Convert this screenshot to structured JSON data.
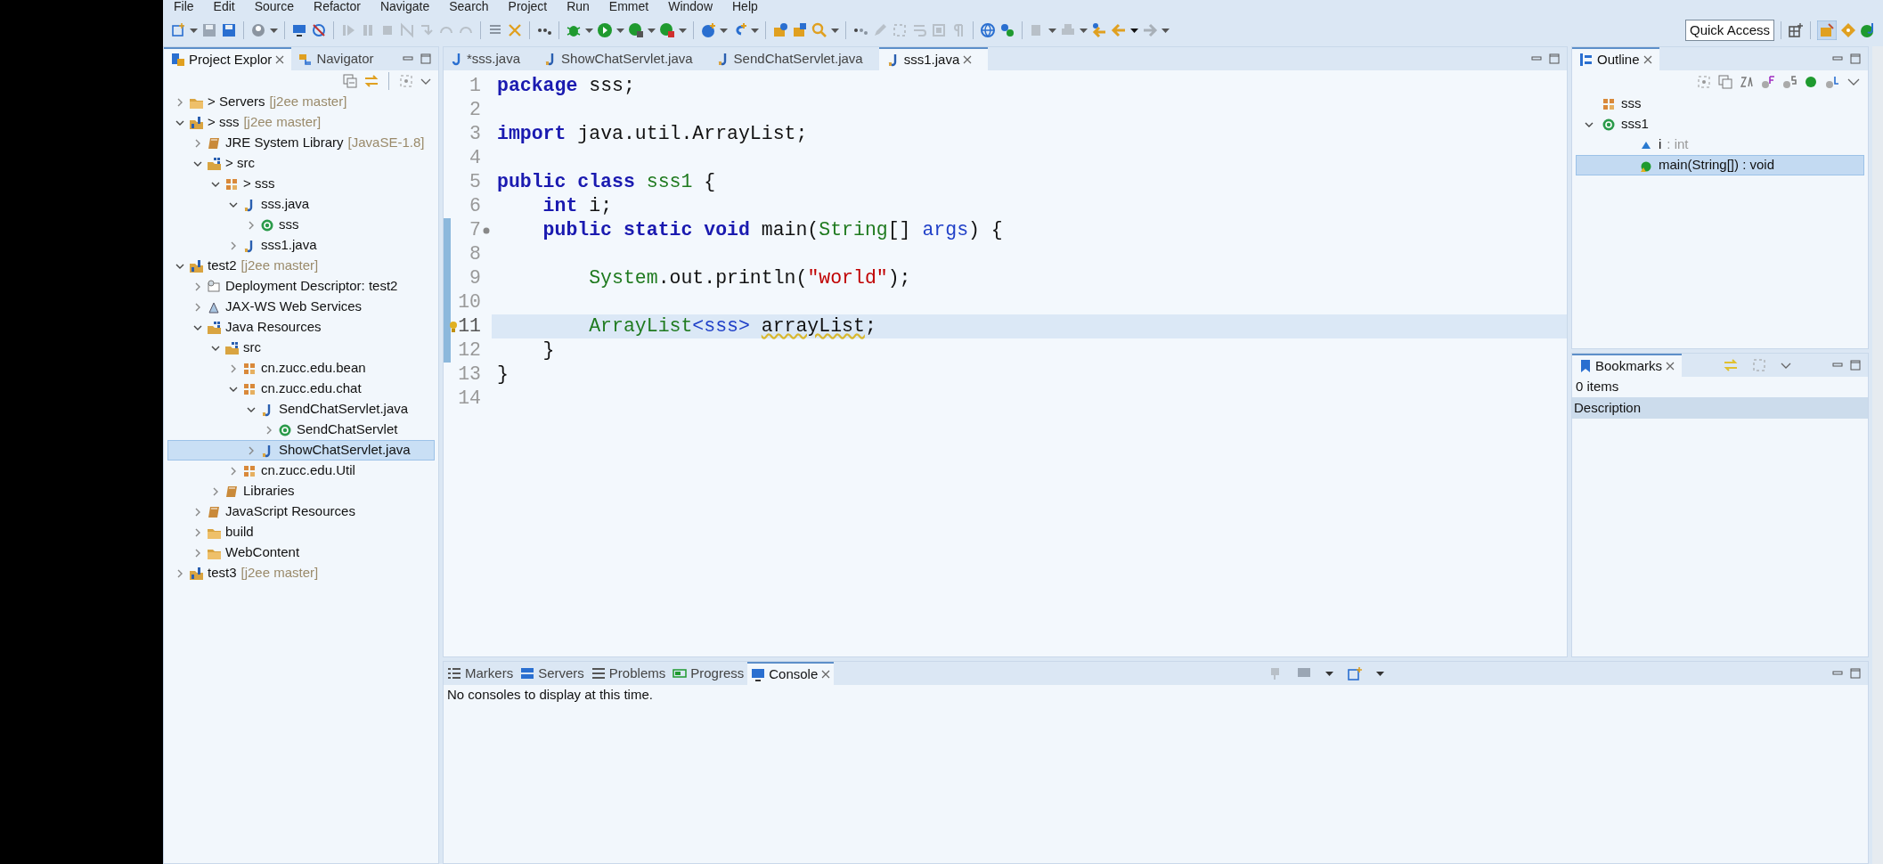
{
  "menu": [
    "File",
    "Edit",
    "Source",
    "Refactor",
    "Navigate",
    "Search",
    "Project",
    "Run",
    "Emmet",
    "Window",
    "Help"
  ],
  "toolbar": {
    "quick_access": "Quick Access"
  },
  "project_explorer": {
    "tabs": [
      {
        "label": "Project Explor",
        "selected": true
      },
      {
        "label": "Navigator",
        "selected": false
      }
    ],
    "tree": [
      {
        "label": "> Servers",
        "decoration": "[j2ee master]",
        "kind": "folder",
        "expanded": false,
        "selected": false
      },
      {
        "label": "> sss",
        "decoration": "[j2ee master]",
        "kind": "project",
        "expanded": true,
        "selected": false,
        "children": [
          {
            "label": "JRE System Library",
            "decoration": "[JavaSE-1.8]",
            "kind": "library",
            "expanded": false,
            "selected": false
          },
          {
            "label": "> src",
            "kind": "source-folder",
            "expanded": true,
            "selected": false,
            "children": [
              {
                "label": "> sss",
                "kind": "package",
                "expanded": true,
                "selected": false,
                "children": [
                  {
                    "label": "sss.java",
                    "kind": "java-file",
                    "expanded": true,
                    "selected": false,
                    "children": [
                      {
                        "label": "sss",
                        "kind": "class",
                        "expanded": false,
                        "selected": false
                      }
                    ]
                  },
                  {
                    "label": "sss1.java",
                    "kind": "java-file",
                    "expanded": false,
                    "selected": false
                  }
                ]
              }
            ]
          }
        ]
      },
      {
        "label": "test2",
        "decoration": "[j2ee master]",
        "kind": "project",
        "expanded": true,
        "selected": false,
        "children": [
          {
            "label": "Deployment Descriptor: test2",
            "kind": "descriptor",
            "expanded": false,
            "selected": false
          },
          {
            "label": "JAX-WS Web Services",
            "kind": "webservice",
            "expanded": false,
            "selected": false
          },
          {
            "label": "Java Resources",
            "kind": "source-folder",
            "expanded": true,
            "selected": false,
            "children": [
              {
                "label": "src",
                "kind": "source-folder",
                "expanded": true,
                "selected": false,
                "children": [
                  {
                    "label": "cn.zucc.edu.bean",
                    "kind": "package",
                    "expanded": false,
                    "selected": false
                  },
                  {
                    "label": "cn.zucc.edu.chat",
                    "kind": "package",
                    "expanded": true,
                    "selected": false,
                    "children": [
                      {
                        "label": "SendChatServlet.java",
                        "kind": "java-file",
                        "expanded": true,
                        "selected": false,
                        "children": [
                          {
                            "label": "SendChatServlet",
                            "kind": "class",
                            "expanded": false,
                            "selected": false
                          }
                        ]
                      },
                      {
                        "label": "ShowChatServlet.java",
                        "kind": "java-file",
                        "expanded": false,
                        "selected": true
                      }
                    ]
                  },
                  {
                    "label": "cn.zucc.edu.Util",
                    "kind": "package",
                    "expanded": false,
                    "selected": false
                  }
                ]
              },
              {
                "label": "Libraries",
                "kind": "library",
                "expanded": false,
                "selected": false
              }
            ]
          },
          {
            "label": "JavaScript Resources",
            "kind": "library",
            "expanded": false,
            "selected": false
          },
          {
            "label": "build",
            "kind": "folder",
            "expanded": false,
            "selected": false
          },
          {
            "label": "WebContent",
            "kind": "folder",
            "expanded": false,
            "selected": false
          }
        ]
      },
      {
        "label": "test3",
        "decoration": "[j2ee master]",
        "kind": "project",
        "expanded": false,
        "selected": false
      }
    ]
  },
  "editor": {
    "tabs": [
      {
        "label": "*sss.java",
        "selected": false
      },
      {
        "label": "ShowChatServlet.java",
        "selected": false
      },
      {
        "label": "SendChatServlet.java",
        "selected": false
      },
      {
        "label": "sss1.java",
        "selected": true
      }
    ],
    "lines": [
      {
        "number": "1",
        "current": false,
        "range": false,
        "override": false,
        "warning": false,
        "tokens": [
          {
            "kind": "keyword",
            "text": "package"
          },
          {
            "kind": "plain",
            "text": " sss;"
          }
        ]
      },
      {
        "number": "2",
        "current": false,
        "range": false,
        "override": false,
        "warning": false
      },
      {
        "number": "3",
        "current": false,
        "range": false,
        "override": false,
        "warning": false,
        "tokens": [
          {
            "kind": "keyword",
            "text": "import"
          },
          {
            "kind": "plain",
            "text": " java.util.ArrayList;"
          }
        ]
      },
      {
        "number": "4",
        "current": false,
        "range": false,
        "override": false,
        "warning": false
      },
      {
        "number": "5",
        "current": false,
        "range": false,
        "override": false,
        "warning": false,
        "tokens": [
          {
            "kind": "keyword",
            "text": "public class"
          },
          {
            "kind": "type",
            "text": " sss1"
          },
          {
            "kind": "plain",
            "text": " {"
          }
        ]
      },
      {
        "number": "6",
        "current": false,
        "range": false,
        "override": false,
        "warning": false,
        "tokens": [
          {
            "kind": "keyword",
            "text": "    int"
          },
          {
            "kind": "plain",
            "text": " i;"
          }
        ]
      },
      {
        "number": "7",
        "current": false,
        "range": true,
        "override": true,
        "warning": false,
        "tokens": [
          {
            "kind": "keyword",
            "text": "    public static void"
          },
          {
            "kind": "plain",
            "text": " main("
          },
          {
            "kind": "type",
            "text": "String"
          },
          {
            "kind": "plain",
            "text": "[] "
          },
          {
            "kind": "param",
            "text": "args"
          },
          {
            "kind": "plain",
            "text": ") {"
          }
        ]
      },
      {
        "number": "8",
        "current": false,
        "range": true,
        "override": false,
        "warning": false
      },
      {
        "number": "9",
        "current": false,
        "range": true,
        "override": false,
        "warning": false,
        "tokens": [
          {
            "kind": "type",
            "text": "        System"
          },
          {
            "kind": "plain",
            "text": ".out.println("
          },
          {
            "kind": "string",
            "text": "\"world\""
          },
          {
            "kind": "plain",
            "text": ");"
          }
        ]
      },
      {
        "number": "10",
        "current": false,
        "range": true,
        "override": false,
        "warning": false
      },
      {
        "number": "11",
        "current": true,
        "range": true,
        "override": false,
        "warning": true,
        "tokens": [
          {
            "kind": "type",
            "text": "        ArrayList"
          },
          {
            "kind": "param",
            "text": "<sss> "
          },
          {
            "kind": "unused",
            "text": "arrayList"
          },
          {
            "kind": "plain",
            "text": ";"
          }
        ]
      },
      {
        "number": "12",
        "current": false,
        "range": true,
        "override": false,
        "warning": false,
        "tokens": [
          {
            "kind": "plain",
            "text": "    }"
          }
        ]
      },
      {
        "number": "13",
        "current": false,
        "range": false,
        "override": false,
        "warning": false,
        "tokens": [
          {
            "kind": "plain",
            "text": "}"
          }
        ]
      },
      {
        "number": "14",
        "current": false,
        "range": false,
        "override": false,
        "warning": false
      }
    ]
  },
  "outline": {
    "tab": "Outline",
    "items": [
      {
        "label": "sss",
        "kind": "package",
        "selected": false
      },
      {
        "label": "sss1",
        "kind": "class",
        "expanded": true,
        "selected": false,
        "children": [
          {
            "label": "i",
            "detail": ": int",
            "kind": "field",
            "selected": false
          },
          {
            "label": "main(String[]) : void",
            "kind": "method",
            "selected": true
          }
        ]
      }
    ]
  },
  "bookmarks": {
    "tab": "Bookmarks",
    "count": "0 items",
    "columns": [
      "Description"
    ]
  },
  "console": {
    "tabs": [
      {
        "label": "Markers",
        "kind": "markers",
        "selected": false
      },
      {
        "label": "Servers",
        "kind": "servers",
        "selected": false
      },
      {
        "label": "Problems",
        "kind": "problems",
        "selected": false
      },
      {
        "label": "Progress",
        "kind": "progress",
        "selected": false
      },
      {
        "label": "Console",
        "kind": "console",
        "selected": true
      }
    ],
    "message": "No consoles to display at this time."
  }
}
